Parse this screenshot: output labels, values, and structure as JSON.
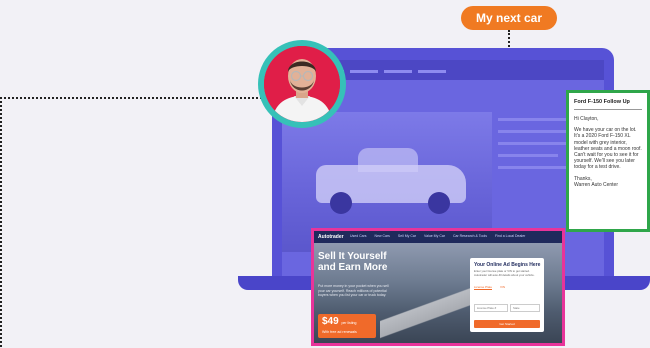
{
  "badge": {
    "label": "My next car"
  },
  "email": {
    "subject": "Ford F-150 Follow Up",
    "greeting": "Hi Clayton,",
    "body": "We have your car on the lot. It's a 2020 Ford F-150 XL model with grey interior, leather seats and a moon roof. Can't wait for you to see it for yourself. We'll see you later today for a test drive.",
    "signoff": "Thanks,",
    "signature": "Warren Auto Center"
  },
  "site": {
    "logo": "Autotrader",
    "nav": [
      "Used Cars",
      "New Cars",
      "Sell My Car",
      "Value My Car",
      "Car Research & Tools",
      "Find a Local Dealer"
    ],
    "hero_title_1": "Sell It Yourself",
    "hero_title_2": "and Earn More",
    "hero_sub": "Put more money in your pocket when you sell your car yourself. Reach millions of potential buyers when you list your car or truck today.",
    "price": "$49",
    "price_suffix": "per listing",
    "price_note": "With free ad renewals",
    "form_title": "Your Online Ad Begins Here",
    "form_desc": "Enter your license plate or VIN to get started. Autotrader will auto-fill details about your vehicle.",
    "form_tab_1": "License Plate",
    "form_tab_2": "VIN",
    "form_input_1": "License Plate #",
    "form_input_2": "State",
    "form_button": "Get Started"
  },
  "colors": {
    "badge": "#f07a22",
    "laptop": "#5752d6",
    "email_border": "#2fa64a",
    "site_border": "#e8349a",
    "avatar_ring": "#36c1b8",
    "avatar_bg": "#e01e48"
  },
  "icons": {
    "avatar": "person-photo"
  }
}
